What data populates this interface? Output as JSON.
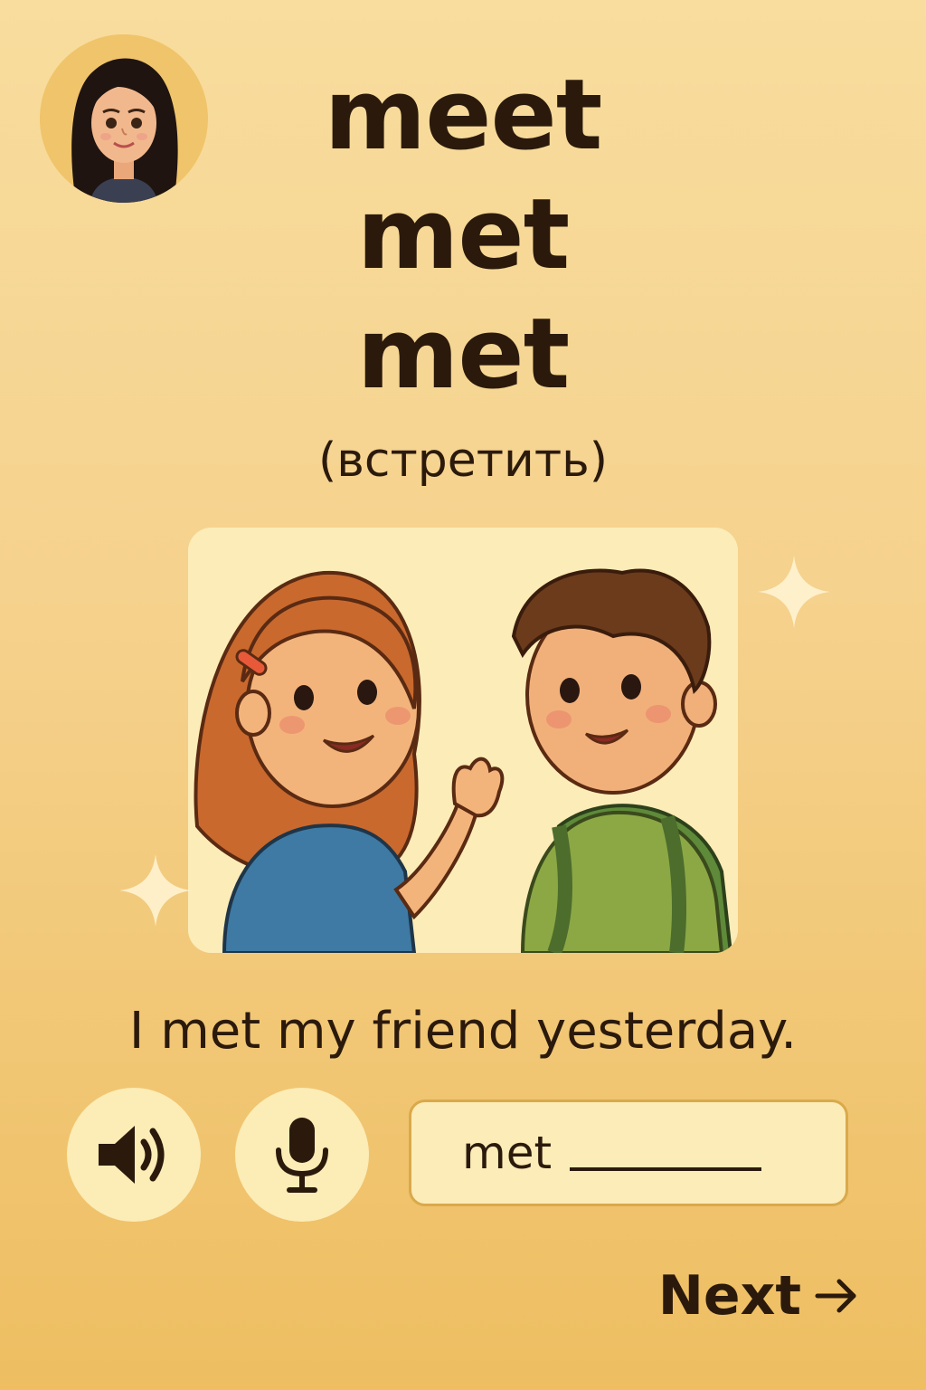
{
  "avatar": {
    "icon": "tutor-avatar"
  },
  "verb_forms": {
    "base": "meet",
    "past_simple": "met",
    "past_participle": "met"
  },
  "translation": "(встретить)",
  "illustration": {
    "icon": "two-kids-meeting-illustration"
  },
  "example_sentence": "I met my friend yesterday.",
  "controls": {
    "speaker_icon": "speaker-icon",
    "mic_icon": "microphone-icon"
  },
  "answer": {
    "prefix": "met",
    "value": ""
  },
  "next": {
    "label": "Next",
    "icon": "arrow-right-icon"
  },
  "colors": {
    "background_top": "#f8dd9e",
    "background_bottom": "#eebe61",
    "text": "#2b1a0c",
    "card": "#fcecb8",
    "field_border": "#d9a94b"
  }
}
